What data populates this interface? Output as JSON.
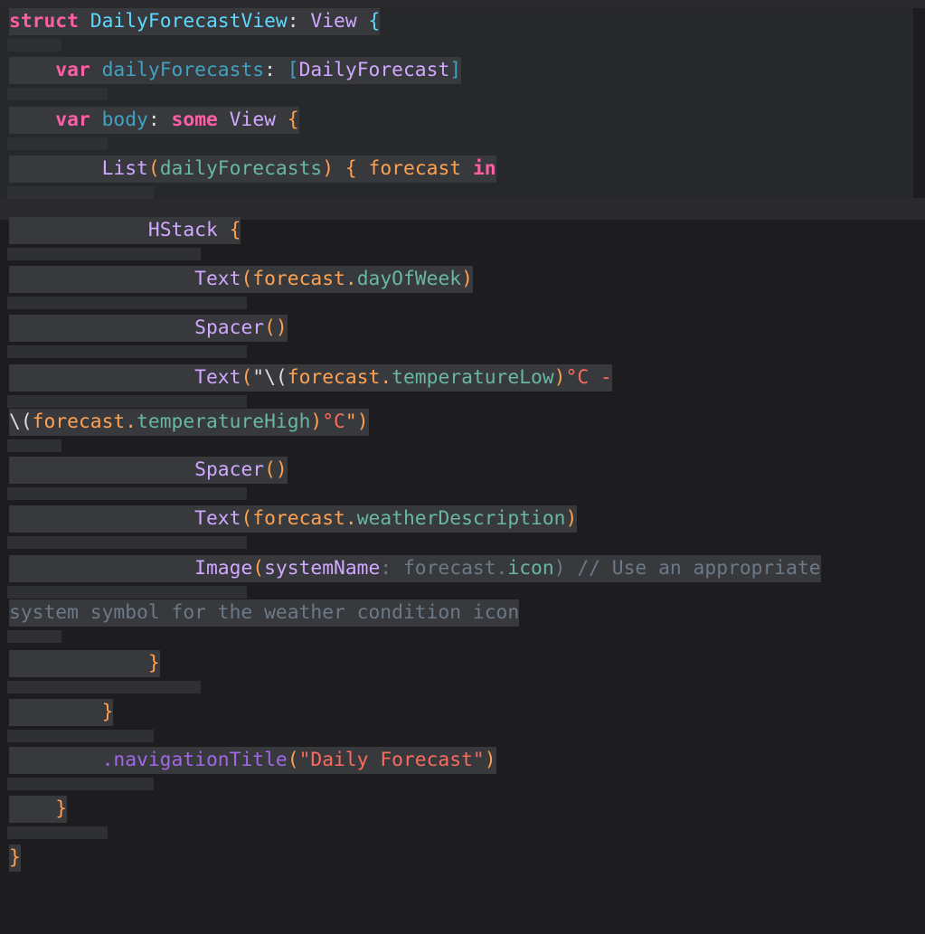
{
  "editor": {
    "language": "swift",
    "theme": "dark",
    "lines": [
      [
        [
          "struct",
          "kw"
        ],
        [
          " ",
          ""
        ],
        [
          "DailyForecastView",
          "st"
        ],
        [
          ":",
          "wt"
        ],
        [
          " ",
          ""
        ],
        [
          "View",
          "tp"
        ],
        [
          " ",
          ""
        ],
        [
          "{",
          "st"
        ]
      ],
      [
        [
          "    ",
          ""
        ],
        [
          "var",
          "kw"
        ],
        [
          " ",
          ""
        ],
        [
          "dailyForecasts",
          "id"
        ],
        [
          ":",
          "wt"
        ],
        [
          " ",
          ""
        ],
        [
          "[",
          "id"
        ],
        [
          "DailyForecast",
          "tp"
        ],
        [
          "]",
          "id"
        ]
      ],
      [
        [
          "    ",
          ""
        ],
        [
          "var",
          "kw"
        ],
        [
          " ",
          ""
        ],
        [
          "body",
          "id"
        ],
        [
          ":",
          "wt"
        ],
        [
          " ",
          ""
        ],
        [
          "some",
          "kw"
        ],
        [
          " ",
          ""
        ],
        [
          "View",
          "tp"
        ],
        [
          " ",
          ""
        ],
        [
          "{",
          "bl"
        ]
      ],
      [
        [
          "        ",
          ""
        ],
        [
          "List",
          "tp"
        ],
        [
          "(",
          "bl"
        ],
        [
          "dailyForecasts",
          "pm"
        ],
        [
          ")",
          "bl"
        ],
        [
          " ",
          ""
        ],
        [
          "{",
          "bl"
        ],
        [
          " ",
          ""
        ],
        [
          "forecast",
          "bl"
        ],
        [
          " ",
          ""
        ],
        [
          "in",
          "kw"
        ]
      ],
      [
        [
          "            ",
          ""
        ],
        [
          "HStack",
          "tp"
        ],
        [
          " ",
          ""
        ],
        [
          "{",
          "bl"
        ]
      ],
      [
        [
          "                ",
          ""
        ],
        [
          "Text",
          "tp"
        ],
        [
          "(",
          "bl"
        ],
        [
          "forecast",
          "bl"
        ],
        [
          ".",
          "bl"
        ],
        [
          "dayOfWeek",
          "pm"
        ],
        [
          ")",
          "bl"
        ]
      ],
      [
        [
          "                ",
          ""
        ],
        [
          "Spacer",
          "tp"
        ],
        [
          "()",
          "bl"
        ]
      ],
      [
        [
          "                ",
          ""
        ],
        [
          "Text",
          "tp"
        ],
        [
          "(",
          "bl"
        ],
        [
          "\"\\(",
          "wt"
        ],
        [
          "forecast",
          "bl"
        ],
        [
          ".",
          "bl"
        ],
        [
          "temperatureLow",
          "pm"
        ],
        [
          ")",
          "bl"
        ],
        [
          "°C -",
          "tx"
        ]
      ],
      [
        [
          "\\(",
          "wt"
        ],
        [
          "forecast",
          "bl"
        ],
        [
          ".",
          "bl"
        ],
        [
          "temperatureHigh",
          "pm"
        ],
        [
          ")",
          "bl"
        ],
        [
          "°C",
          "tx"
        ],
        [
          "\")",
          "bl"
        ]
      ],
      [
        [
          "                ",
          ""
        ],
        [
          "Spacer",
          "tp"
        ],
        [
          "()",
          "bl"
        ]
      ],
      [
        [
          "                ",
          ""
        ],
        [
          "Text",
          "tp"
        ],
        [
          "(",
          "bl"
        ],
        [
          "forecast",
          "bl"
        ],
        [
          ".",
          "bl"
        ],
        [
          "weatherDescription",
          "pm"
        ],
        [
          ")",
          "bl"
        ]
      ],
      [
        [
          "                ",
          ""
        ],
        [
          "Image",
          "tp"
        ],
        [
          "(",
          "bl"
        ],
        [
          "systemName",
          "tp"
        ],
        [
          ":",
          "cm"
        ],
        [
          " ",
          ""
        ],
        [
          "forecast",
          "cm"
        ],
        [
          ".",
          "cm"
        ],
        [
          "icon",
          "pm"
        ],
        [
          ")",
          "cm"
        ],
        [
          " ",
          ""
        ],
        [
          "// Use an appropriate",
          "cm"
        ]
      ],
      [
        [
          "system symbol for the weather condition icon",
          "cm"
        ]
      ],
      [
        [
          "            ",
          ""
        ],
        [
          "}",
          "bl"
        ]
      ],
      [
        [
          "        ",
          ""
        ],
        [
          "}",
          "bl"
        ]
      ],
      [
        [
          "        ",
          ""
        ],
        [
          ".navigationTitle",
          "fn"
        ],
        [
          "(",
          "bl"
        ],
        [
          "\"Daily Forecast\"",
          "tx"
        ],
        [
          ")",
          "bl"
        ]
      ],
      [
        [
          "    ",
          ""
        ],
        [
          "}",
          "bl"
        ]
      ],
      [
        [
          "}",
          "bl"
        ]
      ]
    ]
  }
}
